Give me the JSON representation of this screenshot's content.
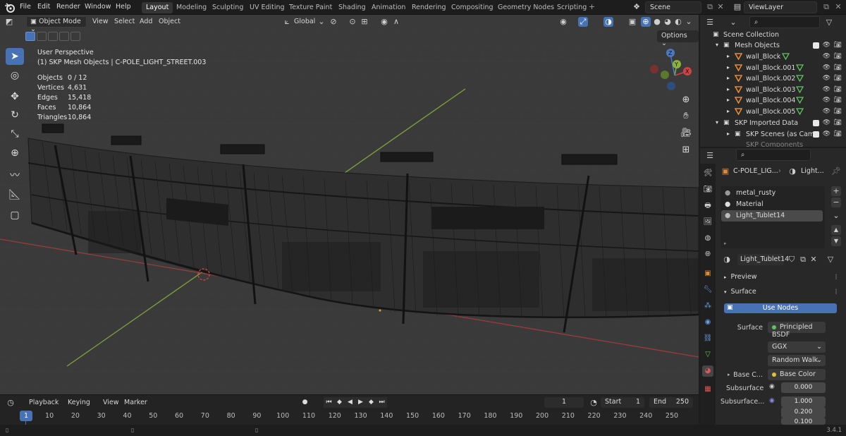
{
  "menus": [
    "File",
    "Edit",
    "Render",
    "Window",
    "Help"
  ],
  "workspaces": [
    "Layout",
    "Modeling",
    "Sculpting",
    "UV Editing",
    "Texture Paint",
    "Shading",
    "Animation",
    "Rendering",
    "Compositing",
    "Geometry Nodes",
    "Scripting"
  ],
  "active_workspace": "Layout",
  "scene_name": "Scene",
  "view_layer": "ViewLayer",
  "viewport": {
    "mode": "Object Mode",
    "menus": [
      "View",
      "Select",
      "Add",
      "Object"
    ],
    "transform_orientation": "Global",
    "options_label": "Options",
    "perspective_label": "User Perspective",
    "active_object_label": "(1) SKP Mesh Objects | C-POLE_LIGHT_STREET.003",
    "stats": [
      {
        "label": "Objects",
        "value": "0 / 12"
      },
      {
        "label": "Vertices",
        "value": "4,631"
      },
      {
        "label": "Edges",
        "value": "15,418"
      },
      {
        "label": "Faces",
        "value": "10,864"
      },
      {
        "label": "Triangles",
        "value": "10,864"
      }
    ],
    "gizmo_axes": [
      "X",
      "Y",
      "Z"
    ]
  },
  "timeline": {
    "menus": [
      "Playback",
      "Keying",
      "View",
      "Marker"
    ],
    "current_frame": "1",
    "start_label": "Start",
    "start": "1",
    "end_label": "End",
    "end": "250",
    "ticks": [
      "1",
      "10",
      "20",
      "30",
      "40",
      "50",
      "60",
      "70",
      "80",
      "90",
      "100",
      "110",
      "120",
      "130",
      "140",
      "150",
      "160",
      "170",
      "180",
      "190",
      "200",
      "210",
      "220",
      "230",
      "240",
      "250"
    ]
  },
  "version": "3.4.1",
  "outliner": {
    "rows": [
      {
        "label": "Scene Collection",
        "type": "scene"
      },
      {
        "label": "Mesh Objects",
        "type": "collection"
      },
      {
        "label": "wall_Block",
        "type": "object"
      },
      {
        "label": "wall_Block.001",
        "type": "object"
      },
      {
        "label": "wall_Block.002",
        "type": "object"
      },
      {
        "label": "wall_Block.003",
        "type": "object"
      },
      {
        "label": "wall_Block.004",
        "type": "object"
      },
      {
        "label": "wall_Block.005",
        "type": "object"
      },
      {
        "label": "SKP Imported Data",
        "type": "collection"
      },
      {
        "label": "SKP Scenes (as Came",
        "type": "sub"
      },
      {
        "label": "SKP Components",
        "type": "sub"
      }
    ]
  },
  "properties": {
    "breadcrumb_object": "C-POLE_LIG...",
    "breadcrumb_material": "Light...",
    "material_slots": [
      "metal_rusty",
      "Material",
      "Light_Tublet14"
    ],
    "active_material": "Light_Tublet14",
    "preview_label": "Preview",
    "surface_section": "Surface",
    "use_nodes_label": "Use Nodes",
    "surface_label": "Surface",
    "surface_shader": "Principled BSDF",
    "distribution": "GGX",
    "subsurface_method": "Random Walk",
    "base_color_label": "Base C...",
    "base_color_value": "Base Color",
    "subsurface_label": "Subsurface",
    "subsurface_value": "0.000",
    "subsurface_radius_label": "Subsurface...",
    "subsurface_radius": [
      "1.000",
      "0.200",
      "0.100"
    ]
  },
  "colors": {
    "accent": "#4772b3",
    "grid_y_axis": "#8db33d",
    "grid_x_axis": "#a04040",
    "viewport_bg": "#3a3a3a"
  }
}
